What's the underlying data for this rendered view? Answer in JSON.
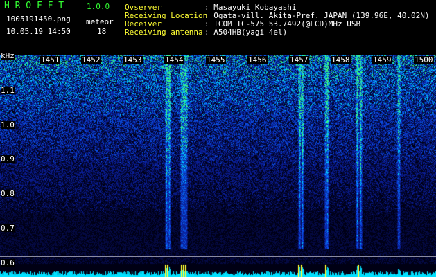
{
  "header": {
    "app_name": "H R O F F T",
    "version": "1.0.0",
    "filename": "1005191450.png",
    "datetime": "10.05.19 14:50",
    "count_label": "meteor",
    "count_value": "18",
    "observer_label": "Ovserver",
    "observer_value": ": Masayuki Kobayashi",
    "location_label": "Receiving Location",
    "location_value": ": Ogata-vill. Akita-Pref. JAPAN (139.96E, 40.02N)",
    "receiver_label": "Receiver",
    "receiver_value": ": ICOM IC-575 53.7492(@LCD)MHz USB",
    "antenna_label": "Receiving antenna",
    "antenna_value": ": A504HB(yagi 4el)"
  },
  "spectrogram": {
    "y_unit": "kHz",
    "y_ticks": [
      "1.1",
      "1.0",
      "0.9",
      "0.8",
      "0.7",
      "0.6"
    ],
    "x_ticks": [
      "1451",
      "1452",
      "1453",
      "1454",
      "1455",
      "1456",
      "1457",
      "1458",
      "1459",
      "1500"
    ],
    "colors": {
      "background": "#000000",
      "text": "#ffffff",
      "title": "#33ff33",
      "meteor_marker": "#ffff33",
      "noise_floor": "#00e0ff"
    }
  }
}
